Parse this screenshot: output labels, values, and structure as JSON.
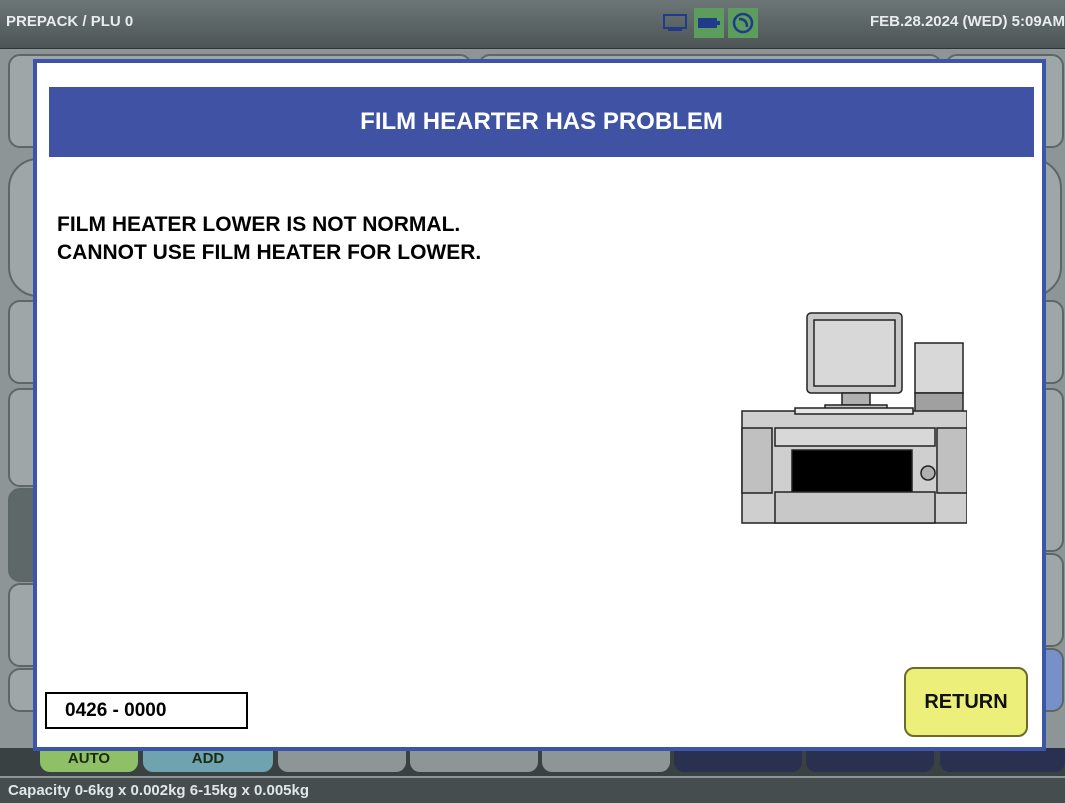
{
  "header": {
    "mode": "PREPACK / PLU 0",
    "datetime": "FEB.28.2024 (WED)   5:09AM",
    "status_icons": [
      "display-icon",
      "battery-icon",
      "network-icon"
    ]
  },
  "dialog": {
    "title": "FILM HEARTER HAS PROBLEM",
    "message_line1": "FILM HEATER LOWER IS NOT NORMAL.",
    "message_line2": "CANNOT USE FILM HEATER FOR LOWER.",
    "error_code": "0426 - 0000",
    "return_label": "RETURN",
    "illustration": "packaging-machine-icon"
  },
  "bottom_tabs": {
    "auto_label": "AUTO",
    "add_label": "ADD"
  },
  "statusbar": {
    "capacity": "Capacity 0-6kg x 0.002kg  6-15kg x 0.005kg"
  },
  "colors": {
    "dialog_border": "#3c55a8",
    "title_bar": "#3f52a3",
    "return_button": "#ecef7a",
    "auto_tab": "#8fbf66",
    "add_tab": "#6fa3b0"
  }
}
